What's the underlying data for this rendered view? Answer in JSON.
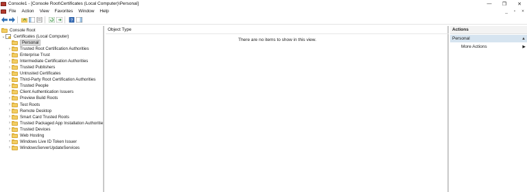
{
  "window": {
    "title": "Console1 - [Console Root\\Certificates (Local Computer)\\Personal]",
    "controls": {
      "minimize": "—",
      "maximize": "❐",
      "close": "✕"
    }
  },
  "menu": {
    "items": [
      "File",
      "Action",
      "View",
      "Favorites",
      "Window",
      "Help"
    ],
    "right": {
      "minimize": "_",
      "restore": "▫",
      "close": "×"
    }
  },
  "tree": {
    "root": "Console Root",
    "certificates": "Certificates (Local Computer)",
    "stores": [
      "Personal",
      "Trusted Root Certification Authorities",
      "Enterprise Trust",
      "Intermediate Certification Authorities",
      "Trusted Publishers",
      "Untrusted Certificates",
      "Third-Party Root Certification Authorities",
      "Trusted People",
      "Client Authentication Issuers",
      "Preview Build Roots",
      "Test Roots",
      "Remote Desktop",
      "Smart Card Trusted Roots",
      "Trusted Packaged App Installation Authorities",
      "Trusted Devices",
      "Web Hosting",
      "Windows Live ID Token Issuer",
      "WindowsServerUpdateServices"
    ],
    "selected_index": 0
  },
  "center": {
    "column_header": "Object Type",
    "empty_message": "There are no items to show in this view."
  },
  "actions": {
    "header": "Actions",
    "section": "Personal",
    "items": [
      "More Actions"
    ]
  },
  "colors": {
    "selection_bg": "#dcdcdc",
    "actions_section_bg": "#d6e4f0",
    "folder": "#f2cd63"
  }
}
